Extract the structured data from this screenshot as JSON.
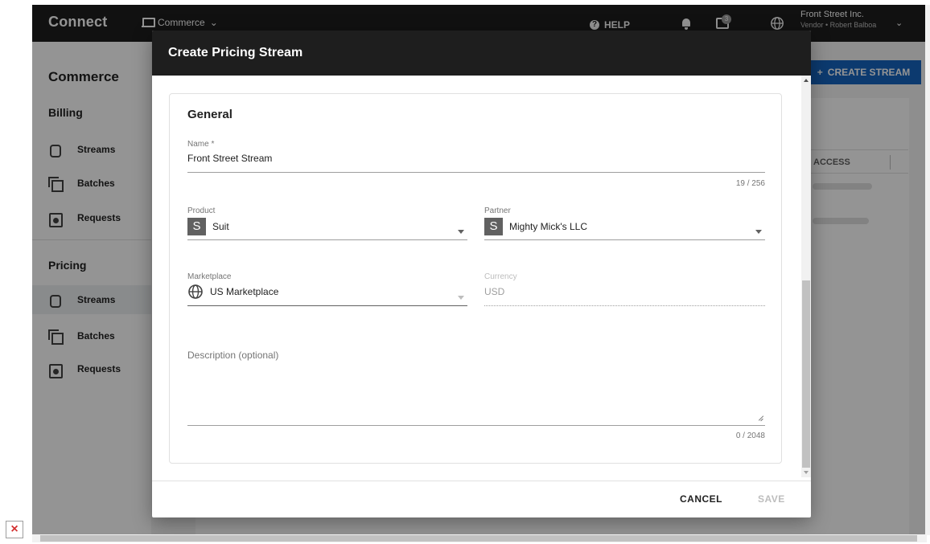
{
  "app": {
    "brand": "Connect",
    "module": "Commerce",
    "help_label": "HELP",
    "notification_count": "3",
    "account_name": "Front Street Inc.",
    "account_sub": "Vendor • Robert Balboa"
  },
  "sidebar": {
    "title": "Commerce",
    "billing": {
      "label": "Billing",
      "items": [
        {
          "label": "Streams",
          "icon": "streams-icon"
        },
        {
          "label": "Batches",
          "icon": "batches-icon"
        },
        {
          "label": "Requests",
          "icon": "requests-icon"
        }
      ]
    },
    "pricing": {
      "label": "Pricing",
      "items": [
        {
          "label": "Streams",
          "icon": "streams-icon",
          "active": true
        },
        {
          "label": "Batches",
          "icon": "batches-icon"
        },
        {
          "label": "Requests",
          "icon": "requests-icon"
        }
      ]
    }
  },
  "main": {
    "create_button_label": "CREATE STREAM",
    "column_header": "ACCESS"
  },
  "dialog": {
    "title": "Create Pricing Stream",
    "section_title": "General",
    "name": {
      "label": "Name *",
      "value": "Front Street Stream",
      "counter": "19 / 256"
    },
    "product": {
      "label": "Product",
      "avatar": "S",
      "value": "Suit"
    },
    "partner": {
      "label": "Partner",
      "avatar": "S",
      "value": "Mighty Mick's LLC"
    },
    "marketplace": {
      "label": "Marketplace",
      "value": "US Marketplace"
    },
    "currency": {
      "label": "Currency",
      "value": "USD"
    },
    "description": {
      "placeholder": "Description (optional)",
      "value": "",
      "counter": "0 / 2048"
    },
    "cancel_label": "CANCEL",
    "save_label": "SAVE"
  },
  "colors": {
    "topbar": "#1e1e1e",
    "primary": "#1565c0",
    "disabled_text": "#bdbdbd"
  }
}
